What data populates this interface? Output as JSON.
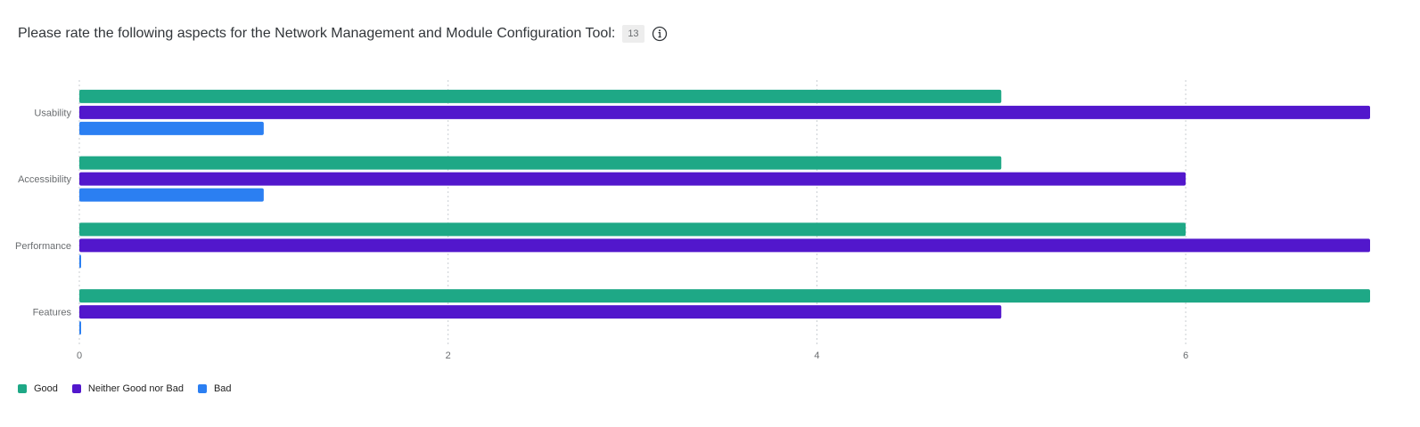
{
  "header": {
    "title": "Please rate the following aspects for the Network Management and Module Configuration Tool:",
    "count": "13",
    "info_icon": "info-circle-icon"
  },
  "colors": {
    "Good": "#1ea886",
    "Neither Good nor Bad": "#5217cc",
    "Bad": "#2b7ff2",
    "grid": "#c9cdd2",
    "tick_label": "#6a6d70"
  },
  "legend": {
    "position": "bottom-left",
    "items": [
      "Good",
      "Neither Good nor Bad",
      "Bad"
    ]
  },
  "chart_data": {
    "type": "bar",
    "orientation": "horizontal",
    "categories": [
      "Usability",
      "Accessibility",
      "Performance",
      "Features"
    ],
    "series": [
      {
        "name": "Good",
        "values": [
          5,
          5,
          6,
          7
        ]
      },
      {
        "name": "Neither Good nor Bad",
        "values": [
          7,
          6,
          7,
          5
        ]
      },
      {
        "name": "Bad",
        "values": [
          1,
          1,
          0,
          0
        ]
      }
    ],
    "xlim": [
      0,
      7
    ],
    "xticks": [
      0,
      2,
      4,
      6
    ],
    "grid": "vertical dotted",
    "title": "",
    "xlabel": "",
    "ylabel": ""
  }
}
